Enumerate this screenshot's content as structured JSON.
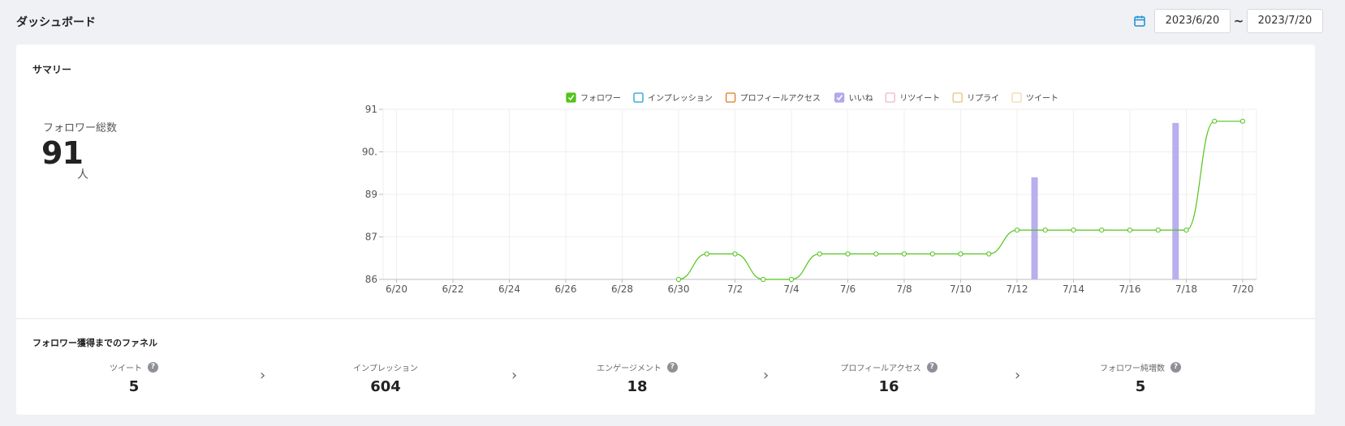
{
  "header": {
    "title": "ダッシュボード",
    "date_from": "2023/6/20",
    "date_sep": "~",
    "date_to": "2023/7/20"
  },
  "summary": {
    "title": "サマリー",
    "kpi_label": "フォロワー総数",
    "kpi_value": "91",
    "kpi_unit": "人"
  },
  "chart_data": {
    "type": "line",
    "title": "",
    "xlabel": "",
    "ylabel": "",
    "ylim": [
      86,
      91
    ],
    "y_ticks": [
      "91",
      "90.",
      "89",
      "87",
      "86"
    ],
    "x_ticks": [
      "6/20",
      "6/22",
      "6/24",
      "6/26",
      "6/28",
      "6/30",
      "7/2",
      "7/4",
      "7/6",
      "7/8",
      "7/10",
      "7/12",
      "7/14",
      "7/16",
      "7/18",
      "7/20"
    ],
    "legend_position": "top-center",
    "grid": true,
    "legend": [
      {
        "name": "フォロワー",
        "color": "#52c41a",
        "checked": true
      },
      {
        "name": "インプレッション",
        "color": "#1a9fd6",
        "checked": false
      },
      {
        "name": "プロフィールアクセス",
        "color": "#e07b1a",
        "checked": false
      },
      {
        "name": "いいね",
        "color": "#b3a8ea",
        "checked": true
      },
      {
        "name": "リツイート",
        "color": "#efb6c8",
        "checked": false
      },
      {
        "name": "リプライ",
        "color": "#e6c37e",
        "checked": false
      },
      {
        "name": "ツイート",
        "color": "#f2d9a8",
        "checked": false
      }
    ],
    "series": [
      {
        "name": "フォロワー",
        "type": "line",
        "color": "#52c41a",
        "x": [
          "6/30",
          "7/1",
          "7/2",
          "7/3",
          "7/4",
          "7/5",
          "7/6",
          "7/7",
          "7/8",
          "7/9",
          "7/10",
          "7/11",
          "7/12",
          "7/13",
          "7/14",
          "7/15",
          "7/16",
          "7/17",
          "7/18",
          "7/19",
          "7/20"
        ],
        "values": [
          86,
          86.75,
          86.75,
          86,
          86,
          86.75,
          86.75,
          86.75,
          86.75,
          86.75,
          86.75,
          86.75,
          87.45,
          87.45,
          87.45,
          87.45,
          87.45,
          87.45,
          87.45,
          90.65,
          90.65
        ]
      },
      {
        "name": "いいね",
        "type": "bar",
        "color": "#b9afee",
        "x": [
          "7/12",
          "7/17"
        ],
        "values": [
          89,
          90.6
        ]
      }
    ]
  },
  "funnel": {
    "title": "フォロワー獲得までのファネル",
    "help_glyph": "?",
    "arrow_glyph": "›",
    "steps": [
      {
        "label": "ツイート",
        "value": "5",
        "help": true
      },
      {
        "label": "インプレッション",
        "value": "604",
        "help": false
      },
      {
        "label": "エンゲージメント",
        "value": "18",
        "help": true
      },
      {
        "label": "プロフィールアクセス",
        "value": "16",
        "help": true
      },
      {
        "label": "フォロワー純増数",
        "value": "5",
        "help": true
      }
    ]
  }
}
